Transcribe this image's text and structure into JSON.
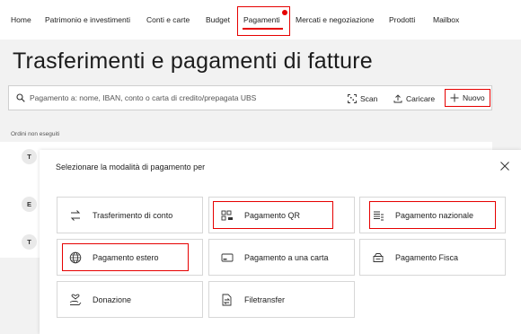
{
  "nav": {
    "items": [
      {
        "label": "Home"
      },
      {
        "label": "Patrimonio e investimenti"
      },
      {
        "label": "Conti e carte"
      },
      {
        "label": "Budget"
      },
      {
        "label": "Pagamenti",
        "active": true
      },
      {
        "label": "Mercati e negoziazione"
      },
      {
        "label": "Prodotti"
      },
      {
        "label": "Mailbox"
      }
    ]
  },
  "page": {
    "title": "Trasferimenti e pagamenti di fatture"
  },
  "search": {
    "placeholder": "Pagamento a: nome, IBAN, conto o carta di credito/prepagata UBS",
    "scan_label": "Scan",
    "upload_label": "Caricare",
    "new_label": "Nuovo"
  },
  "orders": {
    "section_label": "Ordini non eseguiti",
    "initials": [
      "T",
      "E",
      "T"
    ]
  },
  "dialog": {
    "title": "Selezionare la modalità di pagamento per",
    "options": [
      {
        "label": "Trasferimento di conto",
        "icon": "transfer-icon"
      },
      {
        "label": "Pagamento QR",
        "icon": "qr-icon"
      },
      {
        "label": "Pagamento nazionale",
        "icon": "coins-icon"
      },
      {
        "label": "Pagamento estero",
        "icon": "globe-icon"
      },
      {
        "label": "Pagamento a una carta",
        "icon": "card-icon"
      },
      {
        "label": "Pagamento Fisca",
        "icon": "wallet-icon"
      },
      {
        "label": "Donazione",
        "icon": "donation-icon"
      },
      {
        "label": "Filetransfer",
        "icon": "file-transfer-icon"
      }
    ]
  },
  "colors": {
    "accent": "#e60000",
    "background": "#f2f2f2"
  }
}
